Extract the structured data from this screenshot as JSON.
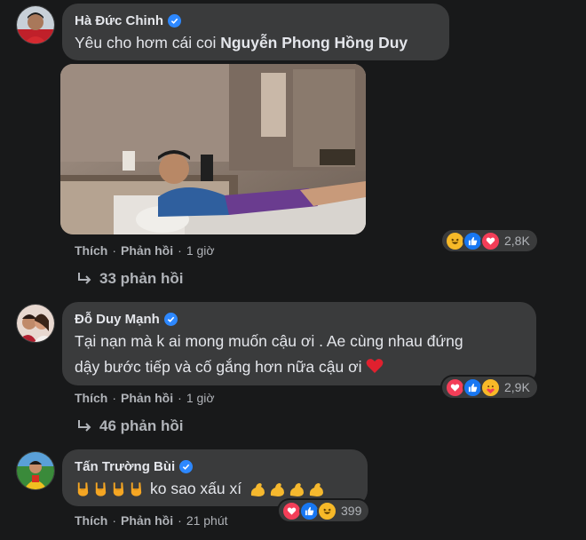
{
  "comments": [
    {
      "author": "Hà Đức Chinh",
      "text_before": "Yêu cho hơm cái coi ",
      "mention": "Nguyễn Phong Hồng Duy",
      "action_like": "Thích",
      "action_reply": "Phản hồi",
      "time": "1 giờ",
      "reaction_count": "2,8K",
      "replies": "33 phản hồi"
    },
    {
      "author": "Đỗ Duy Mạnh",
      "text_line1": "Tại nạn mà k ai mong muốn cậu ơi . Ae cùng nhau đứng",
      "text_line2": "dậy bước tiếp và cố gắng hơn nữa cậu ơi",
      "action_like": "Thích",
      "action_reply": "Phản hồi",
      "time": "1 giờ",
      "reaction_count": "2,9K",
      "replies": "46 phản hồi"
    },
    {
      "author": "Tấn Trường Bùi",
      "text": "ko sao xấu xí",
      "action_like": "Thích",
      "action_reply": "Phản hồi",
      "time": "21 phút",
      "reaction_count": "399"
    }
  ],
  "colors": {
    "background": "#18191a",
    "bubble": "#3a3b3c",
    "verified": "#2d88ff",
    "muted": "#b0b3b8"
  }
}
